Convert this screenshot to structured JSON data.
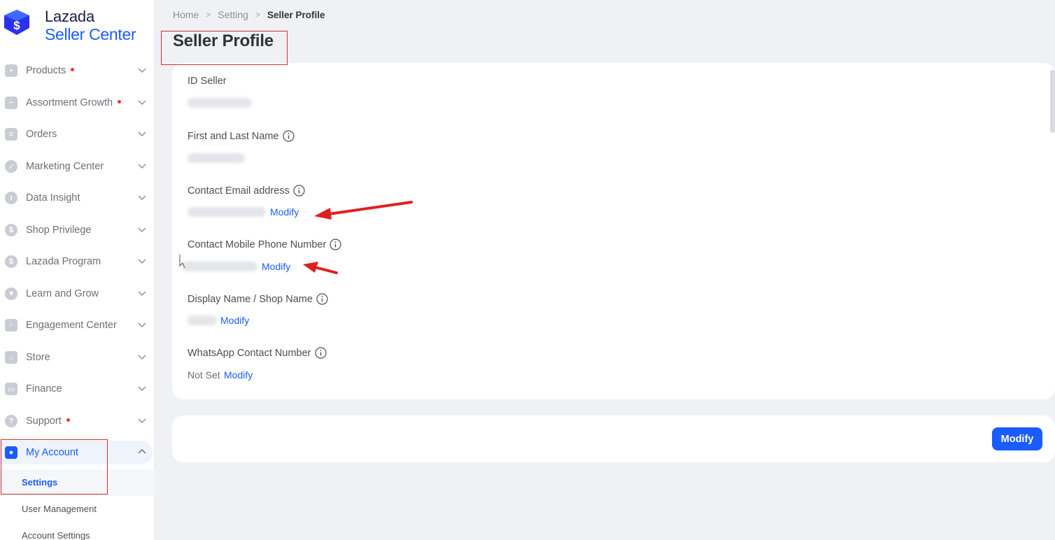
{
  "brand": {
    "line1": "Lazada",
    "line2": "Seller Center"
  },
  "colors": {
    "accent": "#1a5cff",
    "annotation": "#d32f2f",
    "notification_dot": "#e53935"
  },
  "sidebar": {
    "items": [
      {
        "label": "Products",
        "icon": "box-icon",
        "dot": true
      },
      {
        "label": "Assortment Growth",
        "icon": "trend-chart-icon",
        "dot": true
      },
      {
        "label": "Orders",
        "icon": "orders-list-icon",
        "dot": false
      },
      {
        "label": "Marketing Center",
        "icon": "marketing-icon",
        "dot": false
      },
      {
        "label": "Data Insight",
        "icon": "bar-chart-icon",
        "dot": false
      },
      {
        "label": "Shop Privilege",
        "icon": "badge-icon",
        "dot": false
      },
      {
        "label": "Lazada Program",
        "icon": "dollar-icon",
        "dot": false
      },
      {
        "label": "Learn and Grow",
        "icon": "heart-icon",
        "dot": false
      },
      {
        "label": "Engagement Center",
        "icon": "chat-icon",
        "dot": false
      },
      {
        "label": "Store",
        "icon": "store-icon",
        "dot": false
      },
      {
        "label": "Finance",
        "icon": "wallet-icon",
        "dot": false
      },
      {
        "label": "Support",
        "icon": "question-icon",
        "dot": true
      },
      {
        "label": "My Account",
        "icon": "user-icon",
        "dot": false,
        "expanded": true
      }
    ],
    "sub_items": [
      {
        "label": "Settings",
        "active": true
      },
      {
        "label": "User Management",
        "active": false
      },
      {
        "label": "Account Settings",
        "active": false
      }
    ]
  },
  "breadcrumb": {
    "home": "Home",
    "setting": "Setting",
    "current": "Seller Profile"
  },
  "page_title": "Seller Profile",
  "profile": {
    "id_seller": {
      "label": "ID Seller"
    },
    "name": {
      "label": "First and Last Name"
    },
    "email": {
      "label": "Contact Email address",
      "action": "Modify"
    },
    "phone": {
      "label": "Contact Mobile Phone Number",
      "action": "Modify"
    },
    "display_name": {
      "label": "Display Name / Shop Name",
      "action": "Modify"
    },
    "whatsapp": {
      "label": "WhatsApp Contact Number",
      "value": "Not Set",
      "action": "Modify"
    }
  },
  "footer": {
    "modify_button": "Modify"
  }
}
